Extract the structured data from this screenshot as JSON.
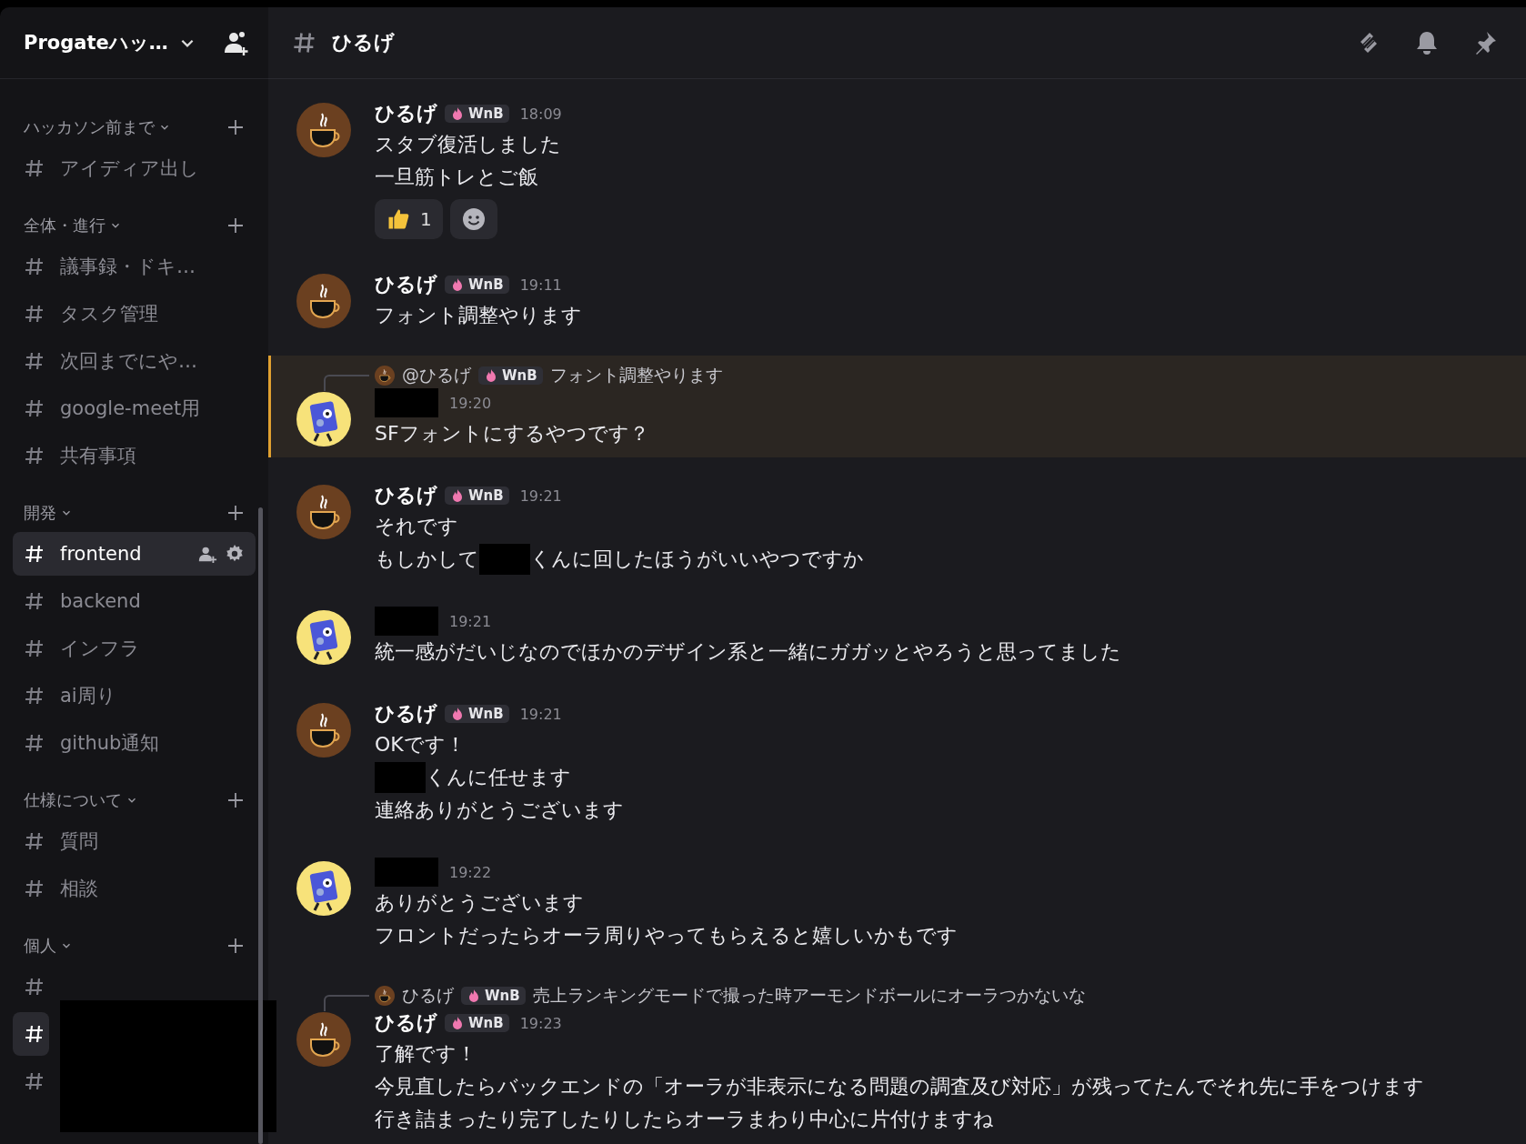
{
  "sidebar": {
    "server_name": "Progateハッ…",
    "categories": [
      {
        "name": "ハッカソン前まで",
        "channels": [
          {
            "name": "アイディア出し",
            "selected": false
          }
        ]
      },
      {
        "name": "全体・進行",
        "channels": [
          {
            "name": "議事録・ドキ…",
            "selected": false
          },
          {
            "name": "タスク管理",
            "selected": false
          },
          {
            "name": "次回までにや…",
            "selected": false
          },
          {
            "name": "google-meet用",
            "selected": false
          },
          {
            "name": "共有事項",
            "selected": false
          }
        ]
      },
      {
        "name": "開発",
        "channels": [
          {
            "name": "frontend",
            "selected": true
          },
          {
            "name": "backend",
            "selected": false
          },
          {
            "name": "インフラ",
            "selected": false
          },
          {
            "name": "ai周り",
            "selected": false
          },
          {
            "name": "github通知",
            "selected": false
          }
        ]
      },
      {
        "name": "仕様について",
        "channels": [
          {
            "name": "質問",
            "selected": false
          },
          {
            "name": "相談",
            "selected": false
          }
        ]
      },
      {
        "name": "個人",
        "redacted": true,
        "channels": [
          {
            "selected": false
          },
          {
            "selected": true
          },
          {
            "selected": false
          }
        ]
      }
    ]
  },
  "header": {
    "channel": "ひるげ"
  },
  "messages": [
    {
      "avatar": {
        "kind": "cup"
      },
      "author": "ひるげ",
      "badge": "WnB",
      "time": "18:09",
      "mentioned": false,
      "lines": [
        [
          "スタブ復活しました"
        ],
        [
          "一旦筋トレとご飯"
        ]
      ],
      "reactions": [
        {
          "kind": "thumbs-up",
          "count": "1"
        }
      ]
    },
    {
      "avatar": {
        "kind": "cup"
      },
      "author": "ひるげ",
      "badge": "WnB",
      "time": "19:11",
      "mentioned": false,
      "lines": [
        [
          "フォント調整やります"
        ]
      ]
    },
    {
      "avatar": {
        "kind": "robot"
      },
      "reply": {
        "author": "@ひるげ",
        "badge": "WnB",
        "text": "フォント調整やります"
      },
      "time": "19:20",
      "mentioned": true,
      "lines": [
        [
          "SFフォントにするやつです？"
        ]
      ]
    },
    {
      "avatar": {
        "kind": "cup"
      },
      "author": "ひるげ",
      "badge": "WnB",
      "time": "19:21",
      "mentioned": false,
      "lines": [
        [
          "それです"
        ],
        [
          "もしかして",
          {
            "redacted": true
          },
          "くんに回したほうがいいやつですか"
        ]
      ]
    },
    {
      "avatar": {
        "kind": "robot"
      },
      "time": "19:21",
      "mentioned": false,
      "lines": [
        [
          "統一感がだいじなのでほかのデザイン系と一緒にガガッとやろうと思ってました"
        ]
      ]
    },
    {
      "avatar": {
        "kind": "cup"
      },
      "author": "ひるげ",
      "badge": "WnB",
      "time": "19:21",
      "mentioned": false,
      "lines": [
        [
          "OKです！"
        ],
        [
          {
            "redacted": true
          },
          "くんに任せます"
        ],
        [
          "連絡ありがとうございます"
        ]
      ]
    },
    {
      "avatar": {
        "kind": "robot"
      },
      "time": "19:22",
      "mentioned": false,
      "lines": [
        [
          "ありがとうございます"
        ],
        [
          "フロントだったらオーラ周りやってもらえると嬉しいかもです"
        ]
      ]
    },
    {
      "avatar": {
        "kind": "cup"
      },
      "reply": {
        "author": "ひるげ",
        "badge": "WnB",
        "text": "売上ランキングモードで撮った時アーモンドボールにオーラつかないな"
      },
      "author": "ひるげ",
      "badge": "WnB",
      "time": "19:23",
      "mentioned": false,
      "lines": [
        [
          "了解です！"
        ],
        [
          "今見直したらバックエンドの「オーラが非表示になる問題の調査及び対応」が残ってたんでそれ先に手をつけます"
        ],
        [
          "行き詰まったり完了したりしたらオーラまわり中心に片付けますね"
        ]
      ]
    }
  ]
}
